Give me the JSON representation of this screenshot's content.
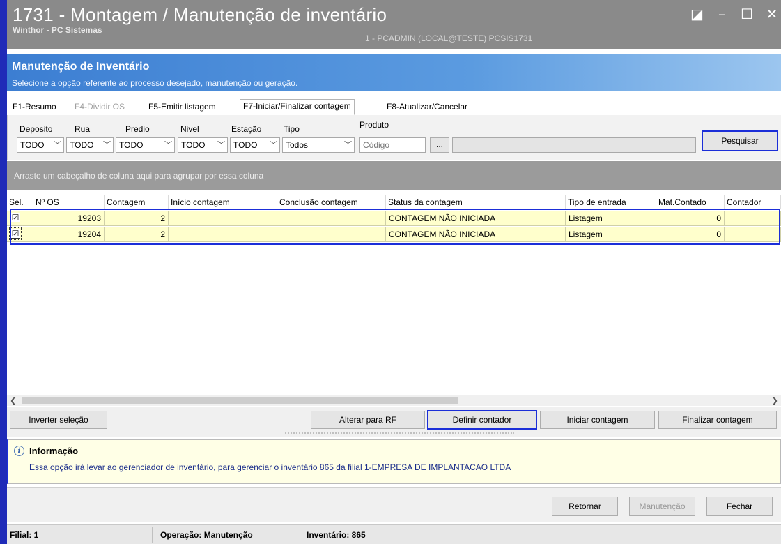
{
  "window": {
    "title": "1731 - Montagem / Manutenção de inventário",
    "subtitle": "Winthor - PC Sistemas",
    "session": "1 - PCADMIN (LOCAL@TESTE)  PCSIS1731",
    "controls": [
      "◪",
      "–",
      "☐",
      "✕"
    ]
  },
  "header": {
    "title": "Manutenção de Inventário",
    "description": "Selecione a opção referente ao processo desejado, manutenção ou geração."
  },
  "tabs": [
    {
      "label": "F1-Resumo",
      "state": "normal"
    },
    {
      "label": "F4-Dividir OS",
      "state": "disabled"
    },
    {
      "label": "F5-Emitir listagem",
      "state": "normal"
    },
    {
      "label": "F7-Iniciar/Finalizar contagem",
      "state": "active"
    },
    {
      "label": "F8-Atualizar/Cancelar",
      "state": "normal"
    }
  ],
  "filters": {
    "deposito": {
      "label": "Deposito",
      "value": "TODO"
    },
    "rua": {
      "label": "Rua",
      "value": "TODO"
    },
    "predio": {
      "label": "Predio",
      "value": "TODO"
    },
    "nivel": {
      "label": "Nivel",
      "value": "TODO"
    },
    "estacao": {
      "label": "Estação",
      "value": "TODO"
    },
    "tipo": {
      "label": "Tipo",
      "value": "Todos"
    },
    "produto": {
      "label": "Produto",
      "placeholder": "Código",
      "browse": "..."
    },
    "search_label": "Pesquisar"
  },
  "grid": {
    "group_hint": "Arraste um cabeçalho de coluna aqui para agrupar por essa coluna",
    "columns": [
      "Sel.",
      "Nº OS",
      "Contagem",
      "Início contagem",
      "Conclusão contagem",
      "Status da contagem",
      "Tipo de entrada",
      "Mat.Contado",
      "Contador"
    ],
    "rows": [
      {
        "checked": "☑",
        "os": "19203",
        "contagem": "2",
        "inicio": "",
        "conclusao": "",
        "status": "CONTAGEM NÃO INICIADA",
        "tipo": "Listagem",
        "mat": "0",
        "contador": ""
      },
      {
        "checked": "☑",
        "os": "19204",
        "contagem": "2",
        "inicio": "",
        "conclusao": "",
        "status": "CONTAGEM NÃO INICIADA",
        "tipo": "Listagem",
        "mat": "0",
        "contador": ""
      }
    ]
  },
  "actions": {
    "invert": "Inverter seleção",
    "alter_rf": "Alterar para RF",
    "define_counter": "Definir contador",
    "start_count": "Iniciar contagem",
    "finish_count": "Finalizar contagem"
  },
  "info": {
    "title": "Informação",
    "message": "Essa opção irá levar ao gerenciador de inventário, para gerenciar o inventário 865 da filial 1-EMPRESA DE IMPLANTACAO LTDA"
  },
  "footer": {
    "return": "Retornar",
    "maintenance": "Manutenção",
    "close": "Fechar"
  },
  "status": {
    "filial": "Filial: 1",
    "operacao": "Operação: Manutenção",
    "inventario": "Inventário: 865"
  },
  "colors": {
    "frame": "#1f2bb8",
    "highlight": "#1b2ed8",
    "row_bg": "#ffffcc",
    "header_blue": "#3c7ed2"
  }
}
